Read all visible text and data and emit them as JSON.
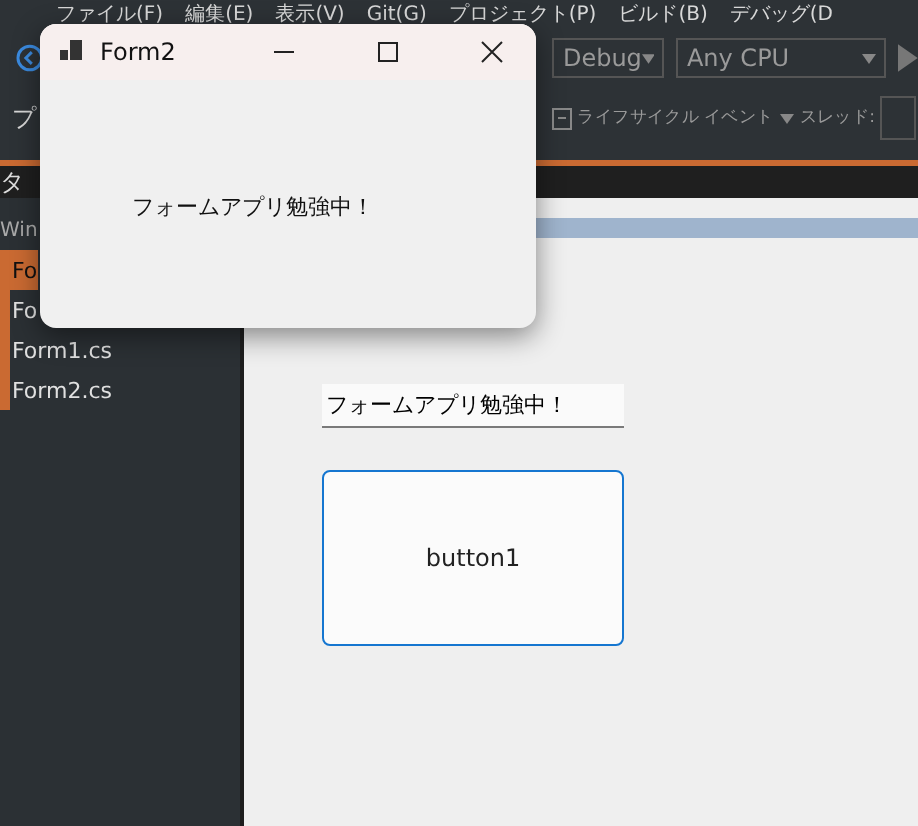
{
  "ide": {
    "menu": [
      "ファイル(F)",
      "編集(E)",
      "表示(V)",
      "Git(G)",
      "プロジェクト(P)",
      "ビルド(B)",
      "デバッグ(D"
    ],
    "toolbar": {
      "configuration": "Debug",
      "platform": "Any CPU"
    },
    "toolbar2": {
      "left_text": "プ",
      "lifecycle": "ライフサイクル イベント",
      "thread_label": "スレッド:"
    },
    "panel_tab": "タ",
    "sidebar": {
      "header": "Win",
      "items": [
        {
          "label": "Fo",
          "selected": true
        },
        {
          "label": "Fo",
          "selected": false
        },
        {
          "label": "Form1.cs",
          "selected": false
        },
        {
          "label": "Form2.cs",
          "selected": false
        }
      ]
    },
    "designer": {
      "textbox": {
        "value": "フォームアプリ勉強中！"
      },
      "button": {
        "label": "button1",
        "focused": true
      }
    }
  },
  "form2": {
    "title": "Form2",
    "label": "フォームアプリ勉強中！"
  }
}
